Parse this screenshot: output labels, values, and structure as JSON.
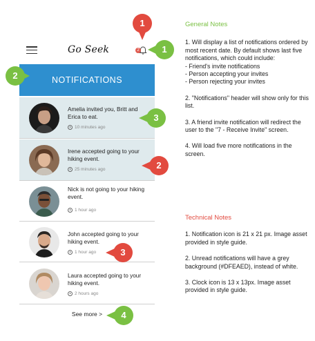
{
  "app": {
    "title": "Go Seek",
    "badge_count": "2",
    "header_title": "NOTIFICATIONS"
  },
  "notifications": [
    {
      "text": "Amelia invited you, Britt and Erica to eat.",
      "time": "10 minutes ago",
      "unread": true
    },
    {
      "text": "Irene accepted going to your hiking event.",
      "time": "25 minutes ago",
      "unread": true
    },
    {
      "text": "Nick is not going to your hiking event.",
      "time": "1 hour ago",
      "unread": false
    },
    {
      "text": "John accepted going to your hiking event.",
      "time": "1 hour ago",
      "unread": false
    },
    {
      "text": "Laura accepted going to your hiking event.",
      "time": "2 hours ago",
      "unread": false
    }
  ],
  "see_more": "See more >",
  "markers": [
    "1",
    "1",
    "2",
    "3",
    "2",
    "3",
    "4"
  ],
  "general_notes": {
    "heading": "General Notes",
    "p1": "1.  Will display a list of notifications ordered by most recent date. By default shows last five notifications, which could include:",
    "p1_items": [
      "- Friend's invite notifications",
      "- Person accepting your invites",
      "- Person rejecting your invites"
    ],
    "p2": "2.  \"Notifications\" header will show only for this list.",
    "p3": "3. A friend invite notification will redirect the user to the \"7 - Receive Invite\" screen.",
    "p4": "4. Will load five more notifications in the screen."
  },
  "technical_notes": {
    "heading": "Technical Notes",
    "p1": "1. Notification icon is 21 x 21 px. Image asset provided in style guide.",
    "p2": "2. Unread notifications will have a grey background (#DFEAED), instead of white.",
    "p3": "3. Clock icon is 13 x 13px. Image asset provided in style guide."
  },
  "colors": {
    "header_blue": "#2e8fcf",
    "unread_bg": "#DFEAED",
    "marker_red": "#e24a3f",
    "marker_green": "#7ac043"
  }
}
